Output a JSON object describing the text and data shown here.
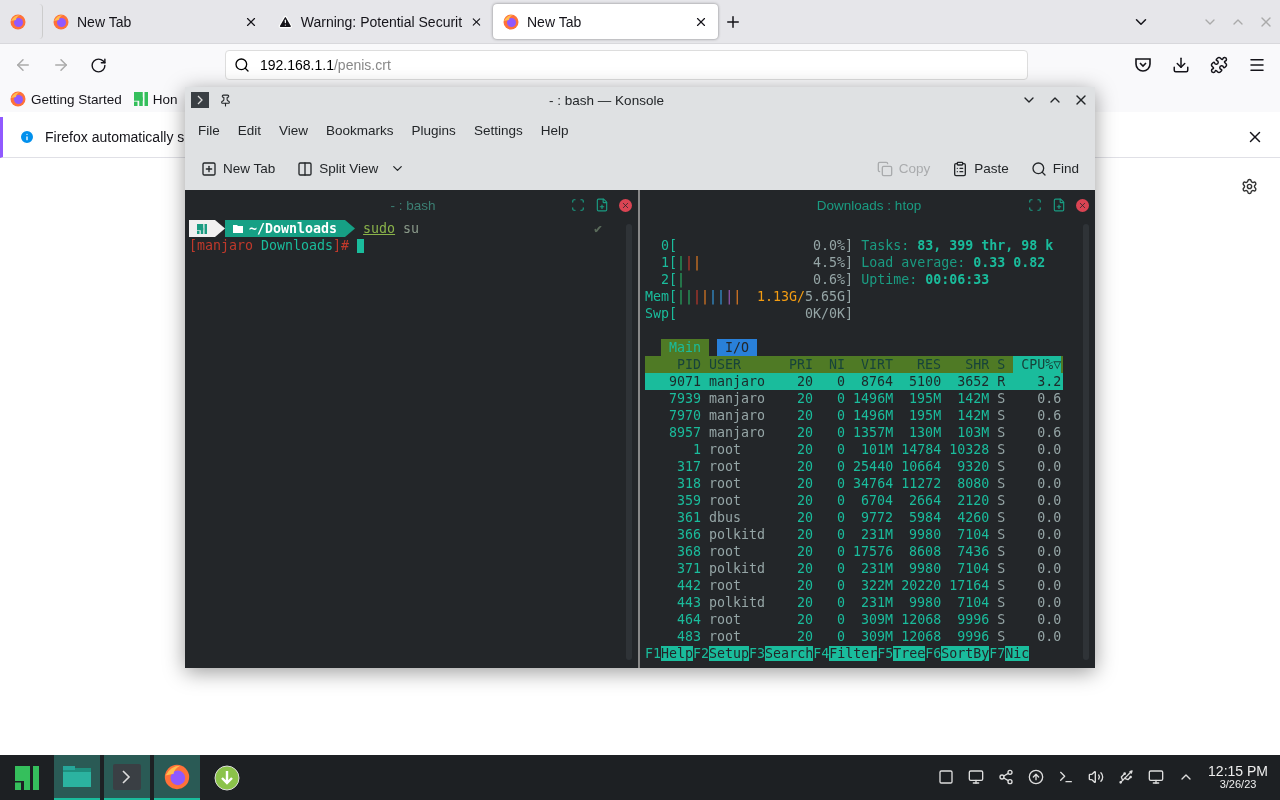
{
  "browser": {
    "tabs": [
      {
        "kind": "pinned",
        "selected": false
      },
      {
        "kind": "page",
        "label": "New Tab",
        "selected": false
      },
      {
        "kind": "warning",
        "label": "Warning: Potential Securit",
        "selected": false
      },
      {
        "kind": "page",
        "label": "New Tab",
        "selected": true
      }
    ],
    "url": {
      "host": "192.168.1.1",
      "path": "/penis.crt"
    },
    "bookmarks": [
      {
        "kind": "firefox",
        "label": "Getting Started"
      },
      {
        "kind": "manjaro",
        "label": "Hon"
      }
    ],
    "notification": "Firefox automatically s"
  },
  "konsole": {
    "title": "- : bash — Konsole",
    "menu": [
      "File",
      "Edit",
      "View",
      "Bookmarks",
      "Plugins",
      "Settings",
      "Help"
    ],
    "toolbar": [
      {
        "kind": "new-tab",
        "label": "New Tab",
        "disabled": false
      },
      {
        "kind": "split",
        "label": "Split View",
        "disabled": false
      },
      {
        "kind": "copy",
        "label": "Copy",
        "disabled": true
      },
      {
        "kind": "paste",
        "label": "Paste",
        "disabled": false
      },
      {
        "kind": "find",
        "label": "Find",
        "disabled": false
      }
    ],
    "bash": {
      "title": "- : bash",
      "focused": false,
      "path": "~/Downloads",
      "command": "sudo",
      "argument": "su",
      "status": "✔",
      "prompt": [
        {
          "text": "[manjaro",
          "color": "#c0392b"
        },
        {
          "text": " Downloads",
          "color": "#1abc9c"
        },
        {
          "text": "]#",
          "color": "#c0392b"
        }
      ]
    },
    "htop": {
      "title": "Downloads : htop",
      "focused": true,
      "meters": [
        {
          "label": "0[",
          "value": "0.0%]"
        },
        {
          "label": "1[",
          "bars": "|||",
          "value": "4.5%]"
        },
        {
          "label": "2[",
          "bars": "|",
          "value": "0.6%]"
        },
        {
          "label": "Mem[",
          "bars": "||||||||",
          "used": "1.13G/",
          "value": "5.65G]"
        },
        {
          "label": "Swp[",
          "value": "0K/0K]"
        }
      ],
      "stats": [
        {
          "label": "Tasks:",
          "value": "83, 399 thr, 98 k"
        },
        {
          "label": "Load average:",
          "value": "0.33 0.82"
        },
        {
          "label": "Uptime:",
          "value": "00:06:33"
        }
      ],
      "tabs": [
        {
          "label": "Main",
          "selected": true
        },
        {
          "label": "I/O",
          "selected": false
        }
      ],
      "columns": [
        {
          "label": "PID",
          "sorted": false
        },
        {
          "label": "USER",
          "sorted": false
        },
        {
          "label": "PRI",
          "sorted": false
        },
        {
          "label": "NI",
          "sorted": false
        },
        {
          "label": "VIRT",
          "sorted": false
        },
        {
          "label": "RES",
          "sorted": false
        },
        {
          "label": "SHR",
          "sorted": false
        },
        {
          "label": "S",
          "sorted": false
        },
        {
          "label": "CPU%▽",
          "sorted": true
        }
      ],
      "rows": [
        {
          "selected": true,
          "cells": [
            "9071",
            "manjaro",
            "20",
            "0",
            "8764",
            "5100",
            "3652",
            "R",
            "3.2"
          ]
        },
        {
          "selected": false,
          "cells": [
            "7939",
            "manjaro",
            "20",
            "0",
            "1496M",
            "195M",
            "142M",
            "S",
            "0.6"
          ]
        },
        {
          "selected": false,
          "cells": [
            "7970",
            "manjaro",
            "20",
            "0",
            "1496M",
            "195M",
            "142M",
            "S",
            "0.6"
          ]
        },
        {
          "selected": false,
          "cells": [
            "8957",
            "manjaro",
            "20",
            "0",
            "1357M",
            "130M",
            "103M",
            "S",
            "0.6"
          ]
        },
        {
          "selected": false,
          "cells": [
            "1",
            "root",
            "20",
            "0",
            "101M",
            "14784",
            "10328",
            "S",
            "0.0"
          ]
        },
        {
          "selected": false,
          "cells": [
            "317",
            "root",
            "20",
            "0",
            "25440",
            "10664",
            "9320",
            "S",
            "0.0"
          ]
        },
        {
          "selected": false,
          "cells": [
            "318",
            "root",
            "20",
            "0",
            "34764",
            "11272",
            "8080",
            "S",
            "0.0"
          ]
        },
        {
          "selected": false,
          "cells": [
            "359",
            "root",
            "20",
            "0",
            "6704",
            "2664",
            "2120",
            "S",
            "0.0"
          ]
        },
        {
          "selected": false,
          "cells": [
            "361",
            "dbus",
            "20",
            "0",
            "9772",
            "5984",
            "4260",
            "S",
            "0.0"
          ]
        },
        {
          "selected": false,
          "cells": [
            "366",
            "polkitd",
            "20",
            "0",
            "231M",
            "9980",
            "7104",
            "S",
            "0.0"
          ]
        },
        {
          "selected": false,
          "cells": [
            "368",
            "root",
            "20",
            "0",
            "17576",
            "8608",
            "7436",
            "S",
            "0.0"
          ]
        },
        {
          "selected": false,
          "cells": [
            "371",
            "polkitd",
            "20",
            "0",
            "231M",
            "9980",
            "7104",
            "S",
            "0.0"
          ]
        },
        {
          "selected": false,
          "cells": [
            "442",
            "root",
            "20",
            "0",
            "322M",
            "20220",
            "17164",
            "S",
            "0.0"
          ]
        },
        {
          "selected": false,
          "cells": [
            "443",
            "polkitd",
            "20",
            "0",
            "231M",
            "9980",
            "7104",
            "S",
            "0.0"
          ]
        },
        {
          "selected": false,
          "cells": [
            "464",
            "root",
            "20",
            "0",
            "309M",
            "12068",
            "9996",
            "S",
            "0.0"
          ]
        },
        {
          "selected": false,
          "cells": [
            "483",
            "root",
            "20",
            "0",
            "309M",
            "12068",
            "9996",
            "S",
            "0.0"
          ]
        }
      ],
      "keys": [
        {
          "key": "F1",
          "label": "Help"
        },
        {
          "key": "F2",
          "label": "Setup"
        },
        {
          "key": "F3",
          "label": "Search"
        },
        {
          "key": "F4",
          "label": "Filter"
        },
        {
          "key": "F5",
          "label": "Tree"
        },
        {
          "key": "F6",
          "label": "SortBy"
        },
        {
          "key": "F7",
          "label": "Nic"
        }
      ]
    }
  },
  "taskbar": {
    "items": [
      {
        "kind": "menu",
        "active": false
      },
      {
        "kind": "files",
        "active": true
      },
      {
        "kind": "terminal",
        "active": true
      },
      {
        "kind": "firefox",
        "active": true
      },
      {
        "kind": "updates",
        "active": false
      }
    ],
    "time": "12:15 PM",
    "date": "3/26/23"
  }
}
